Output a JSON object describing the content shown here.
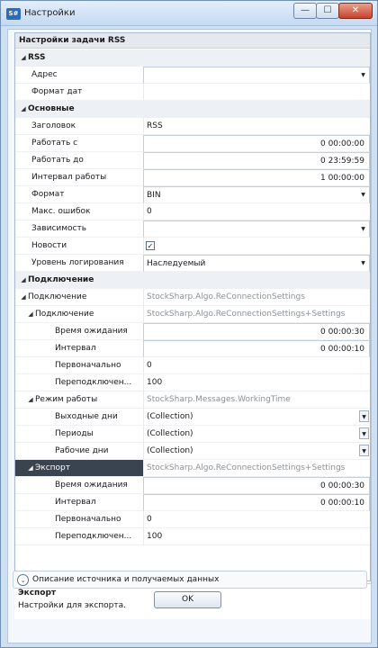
{
  "window": {
    "app_icon": "S#",
    "title": "Настройки",
    "minimize_glyph": "—",
    "maximize_glyph": "☐",
    "close_glyph": "✕"
  },
  "grid": {
    "title": "Настройки задачи RSS",
    "rows": [
      {
        "type": "cat",
        "name": "RSS"
      },
      {
        "type": "prop",
        "level": 2,
        "name": "Адрес",
        "value": "",
        "style": "box",
        "dropdown": "plain"
      },
      {
        "type": "prop",
        "level": 2,
        "name": "Формат дат",
        "value": "",
        "style": "plain"
      },
      {
        "type": "cat",
        "name": "Основные"
      },
      {
        "type": "prop",
        "level": 2,
        "name": "Заголовок",
        "value": "RSS",
        "style": "plain"
      },
      {
        "type": "prop",
        "level": 2,
        "name": "Работать с",
        "value": "0 00:00:00",
        "style": "box-right"
      },
      {
        "type": "prop",
        "level": 2,
        "name": "Работать до",
        "value": "0 23:59:59",
        "style": "box-right"
      },
      {
        "type": "prop",
        "level": 2,
        "name": "Интервал работы",
        "value": "1 00:00:00",
        "style": "box-right"
      },
      {
        "type": "prop",
        "level": 2,
        "name": "Формат",
        "value": "BIN",
        "style": "box-txt",
        "dropdown": "plain"
      },
      {
        "type": "prop",
        "level": 2,
        "name": "Макс. ошибок",
        "value": "0",
        "style": "plain"
      },
      {
        "type": "prop",
        "level": 2,
        "name": "Зависимость",
        "value": "",
        "style": "box",
        "dropdown": "plain"
      },
      {
        "type": "prop",
        "level": 2,
        "name": "Новости",
        "value": "",
        "style": "check",
        "checked": "✓"
      },
      {
        "type": "prop",
        "level": 2,
        "name": "Уровень логирования",
        "value": "Наследуемый",
        "style": "box-txt",
        "dropdown": "plain"
      },
      {
        "type": "cat",
        "name": "Подключение"
      },
      {
        "type": "prop",
        "level": 1,
        "tri": "◢",
        "name": "Подключение",
        "value": "StockSharp.Algo.ReConnectionSettings",
        "style": "dim"
      },
      {
        "type": "prop",
        "level": 2,
        "tri": "◢",
        "name": "Подключение",
        "value": "StockSharp.Algo.ReConnectionSettings+Settings",
        "style": "dim"
      },
      {
        "type": "prop",
        "level": 4,
        "name": "Время ожидания",
        "value": "0 00:00:30",
        "style": "box-right"
      },
      {
        "type": "prop",
        "level": 4,
        "name": "Интервал",
        "value": "0 00:00:10",
        "style": "box-right"
      },
      {
        "type": "prop",
        "level": 4,
        "name": "Первоначально",
        "value": "0",
        "style": "plain"
      },
      {
        "type": "prop",
        "level": 4,
        "name": "Переподключен...",
        "value": "100",
        "style": "plain"
      },
      {
        "type": "prop",
        "level": 2,
        "tri": "◢",
        "name": "Режим работы",
        "value": "StockSharp.Messages.WorkingTime",
        "style": "dim"
      },
      {
        "type": "prop",
        "level": 4,
        "name": "Выходные дни",
        "value": "(Collection)",
        "style": "txt",
        "dropdown": "boxed"
      },
      {
        "type": "prop",
        "level": 4,
        "name": "Периоды",
        "value": "(Collection)",
        "style": "txt",
        "dropdown": "boxed"
      },
      {
        "type": "prop",
        "level": 4,
        "name": "Рабочие дни",
        "value": "(Collection)",
        "style": "txt",
        "dropdown": "boxed"
      },
      {
        "type": "prop",
        "level": 2,
        "tri": "◢",
        "name": "Экспорт",
        "value": "StockSharp.Algo.ReConnectionSettings+Settings",
        "style": "dim",
        "selected": true
      },
      {
        "type": "prop",
        "level": 4,
        "name": "Время ожидания",
        "value": "0 00:00:30",
        "style": "box-right"
      },
      {
        "type": "prop",
        "level": 4,
        "name": "Интервал",
        "value": "0 00:00:10",
        "style": "box-right"
      },
      {
        "type": "prop",
        "level": 4,
        "name": "Первоначально",
        "value": "0",
        "style": "plain"
      },
      {
        "type": "prop",
        "level": 4,
        "name": "Переподключен...",
        "value": "100",
        "style": "plain"
      }
    ]
  },
  "description": {
    "title": "Экспорт",
    "text": "Настройки для экспорта."
  },
  "expander": {
    "glyph": "⌄",
    "label": "Описание источника и получаемых данных"
  },
  "ok_button": {
    "label": "OK"
  },
  "icons": {
    "category_expanded": "◢",
    "dropdown": "▼"
  },
  "colors": {
    "window_frame": "#cfe0f3",
    "selection": "#3a4350",
    "close_button": "#c7432d"
  }
}
